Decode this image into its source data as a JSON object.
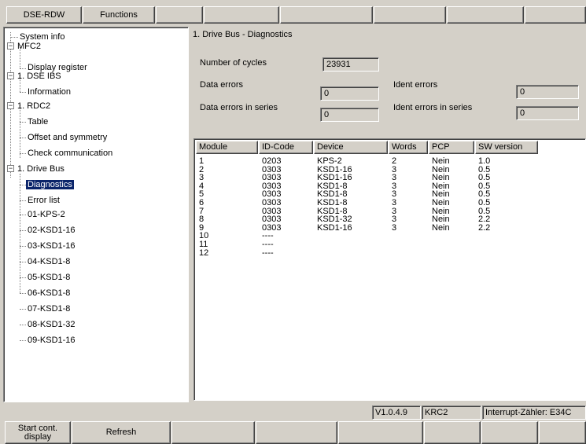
{
  "topbar": {
    "tabs": [
      "DSE-RDW",
      "Functions",
      "",
      "",
      "",
      "",
      "",
      ""
    ]
  },
  "tree": {
    "items": [
      {
        "label": "System info"
      },
      {
        "label": "MFC2"
      },
      {
        "label": "Display register"
      },
      {
        "label": "1. DSE IBS"
      },
      {
        "label": "Information"
      },
      {
        "label": "1. RDC2"
      },
      {
        "label": "Table"
      },
      {
        "label": "Offset and symmetry"
      },
      {
        "label": "Check communication"
      },
      {
        "label": "1. Drive Bus"
      },
      {
        "label": "Diagnostics"
      },
      {
        "label": "Error list"
      },
      {
        "label": "01-KPS-2"
      },
      {
        "label": "02-KSD1-16"
      },
      {
        "label": "03-KSD1-16"
      },
      {
        "label": "04-KSD1-8"
      },
      {
        "label": "05-KSD1-8"
      },
      {
        "label": "06-KSD1-8"
      },
      {
        "label": "07-KSD1-8"
      },
      {
        "label": "08-KSD1-32"
      },
      {
        "label": "09-KSD1-16"
      }
    ]
  },
  "panel": {
    "title": "1. Drive Bus - Diagnostics",
    "cycles_label": "Number of cycles",
    "cycles_value": "23931",
    "data_errors_label": "Data errors",
    "data_errors_value": "0",
    "ident_errors_label": "Ident errors",
    "ident_errors_value": "0",
    "data_errors_series_label": "Data errors in series",
    "data_errors_series_value": "0",
    "ident_errors_series_label": "Ident errors in series",
    "ident_errors_series_value": "0"
  },
  "table": {
    "columns": [
      "Module",
      "ID-Code",
      "Device",
      "Words",
      "PCP",
      "SW version"
    ],
    "rows": [
      [
        "1",
        "0203",
        "KPS-2",
        "2",
        "Nein",
        "1.0"
      ],
      [
        "2",
        "0303",
        "KSD1-16",
        "3",
        "Nein",
        "0.5"
      ],
      [
        "3",
        "0303",
        "KSD1-16",
        "3",
        "Nein",
        "0.5"
      ],
      [
        "4",
        "0303",
        "KSD1-8",
        "3",
        "Nein",
        "0.5"
      ],
      [
        "5",
        "0303",
        "KSD1-8",
        "3",
        "Nein",
        "0.5"
      ],
      [
        "6",
        "0303",
        "KSD1-8",
        "3",
        "Nein",
        "0.5"
      ],
      [
        "7",
        "0303",
        "KSD1-8",
        "3",
        "Nein",
        "0.5"
      ],
      [
        "8",
        "0303",
        "KSD1-32",
        "3",
        "Nein",
        "2.2"
      ],
      [
        "9",
        "0303",
        "KSD1-16",
        "3",
        "Nein",
        "2.2"
      ],
      [
        "10",
        "----",
        "",
        "",
        "",
        ""
      ],
      [
        "11",
        "----",
        "",
        "",
        "",
        ""
      ],
      [
        "12",
        "----",
        "",
        "",
        "",
        ""
      ]
    ]
  },
  "status": {
    "version": "V1.0.4.9",
    "controller": "KRC2",
    "interrupt": "Interrupt-Zähler: E34C"
  },
  "bottombar": {
    "buttons": [
      "Start cont. display",
      "Refresh",
      "",
      "",
      "",
      "",
      "",
      ""
    ]
  },
  "colors": {
    "face": "#d4d0c8",
    "selection": "#0a246a",
    "window": "#ffffff"
  }
}
